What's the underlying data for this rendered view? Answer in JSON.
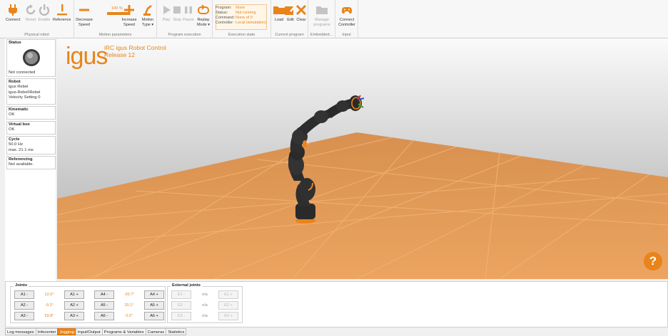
{
  "ribbon": {
    "physical_robot": {
      "label": "Physical robot",
      "connect": "Connect",
      "reset": "Reset",
      "enable": "Enable",
      "reference": "Reference"
    },
    "motion_parameters": {
      "label": "Motion parameters",
      "decrease": "Decrease Speed",
      "speed_value": "100 %",
      "increase": "Increase Speed",
      "motion_type": "Motion Type ▾"
    },
    "program_execution": {
      "label": "Program execution",
      "play": "Play",
      "stop": "Stop",
      "pause": "Pause",
      "replay": "Replay Mode ▾"
    },
    "execution_state": {
      "label": "Execution state",
      "rows": [
        {
          "key": "Program:",
          "value": "None"
        },
        {
          "key": "Status:",
          "value": "Not running"
        },
        {
          "key": "Command:",
          "value": "None of 0"
        },
        {
          "key": "Controller:",
          "value": "Local (simulation)"
        }
      ]
    },
    "current_program": {
      "label": "Current program",
      "load": "Load",
      "edit": "Edit",
      "clear": "Clear"
    },
    "embedded": {
      "label": "Embedded...",
      "manage": "Manage programs"
    },
    "input": {
      "label": "Input",
      "connect_controller": "Connect Controller"
    }
  },
  "status": {
    "status_title": "Status",
    "status_value": "Not connected",
    "robot_title": "Robot",
    "robot_lines": [
      "igus Rebel",
      "igus-Rebel\\Rebel",
      "Velocity Setting 0"
    ],
    "kinematic_title": "Kinematic",
    "kinematic_value": "OK",
    "virtual_title": "Virtual box",
    "virtual_value": "OK",
    "cycle_title": "Cycle",
    "cycle_lines": [
      "50.0 Hz",
      "max. 21.1 ms"
    ],
    "referencing_title": "Referencing",
    "referencing_value": "Not available."
  },
  "viewport": {
    "logo": "igus",
    "title_line1": "iRC igus Robot Control",
    "title_line2": "Release 12",
    "help": "?"
  },
  "joints": {
    "title": "Joints",
    "rows": [
      {
        "minus": "A1 -",
        "value": "12.0°",
        "plus": "A1 +",
        "minus2": "A4 -",
        "value2": "-20.7°",
        "plus2": "A4 +"
      },
      {
        "minus": "A2 -",
        "value": "-9.2°",
        "plus": "A2 +",
        "minus2": "A5 -",
        "value2": "20.1°",
        "plus2": "A5 +"
      },
      {
        "minus": "A3 -",
        "value": "59.8°",
        "plus": "A3 +",
        "minus2": "A6 -",
        "value2": "0.0°",
        "plus2": "A6 +"
      }
    ]
  },
  "external_joints": {
    "title": "External joints",
    "rows": [
      {
        "minus": "E1 -",
        "value": "n/a",
        "plus": "E1 +"
      },
      {
        "minus": "E2 -",
        "value": "n/a",
        "plus": "E2 +"
      },
      {
        "minus": "E3 -",
        "value": "n/a",
        "plus": "E3 +"
      }
    ]
  },
  "tabs": [
    "Log messages",
    "Infocenter",
    "Jogging",
    "Input/Output",
    "Programs & Variables",
    "Cameras",
    "Statistics"
  ],
  "colors": {
    "accent": "#e8841a",
    "floor": "#e8a05a"
  }
}
